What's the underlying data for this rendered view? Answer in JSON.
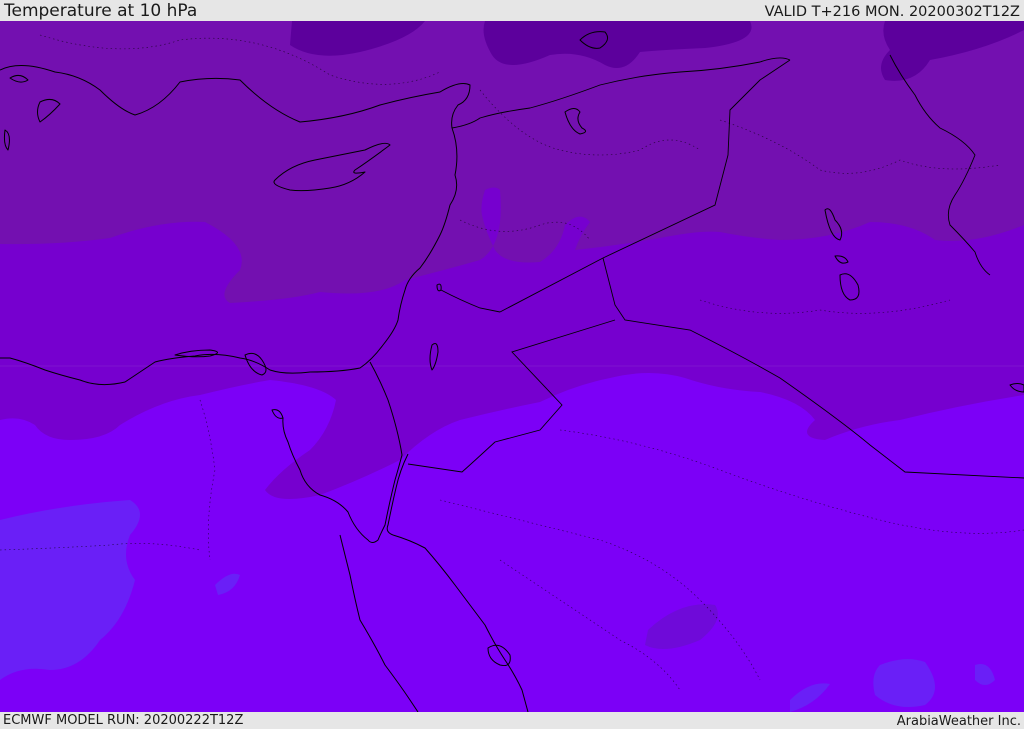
{
  "header": {
    "title": "Temperature at 10 hPa",
    "valid": "VALID T+216 MON. 20200302T12Z"
  },
  "footer": {
    "model_run": "ECMWF MODEL RUN: 20200222T12Z",
    "credit": "ArabiaWeather Inc."
  },
  "colors": {
    "background": "#e6e6e6",
    "band_darkest": "#5c009c",
    "band_dark": "#7310b0",
    "band_mid": "#7600cf",
    "band_bright": "#7c00f7",
    "band_blue": "#6a1ff7",
    "coastline": "#000000"
  }
}
